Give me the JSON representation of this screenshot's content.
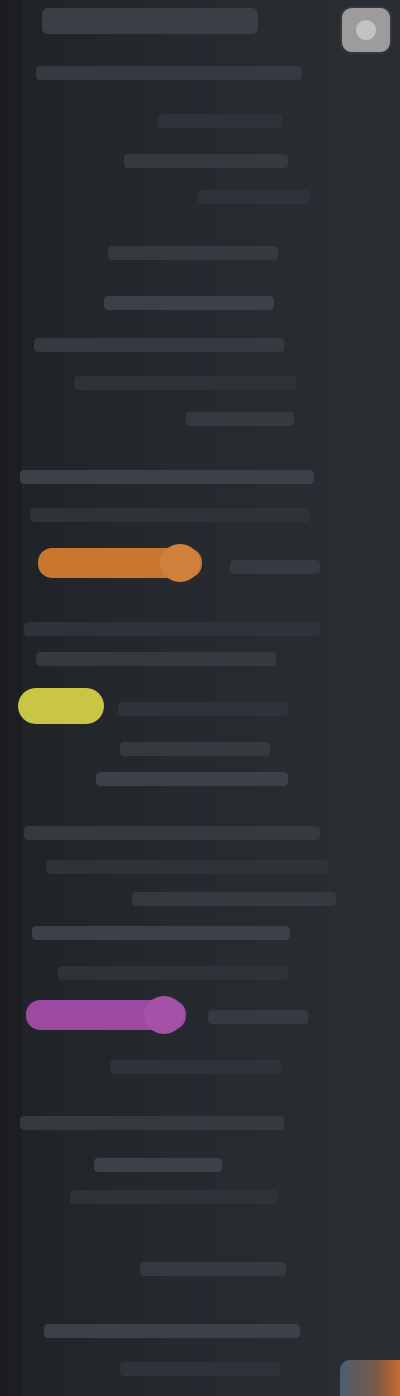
{
  "editor": {
    "tab_title": "",
    "lines": [
      "",
      "",
      "",
      "",
      "",
      "",
      "",
      "",
      "",
      "",
      "",
      "",
      "",
      "",
      "",
      "",
      "",
      "",
      "",
      "",
      "",
      "",
      "",
      "",
      "",
      "",
      "",
      "",
      "",
      ""
    ]
  },
  "colors": {
    "background": "#23272b",
    "highlight_orange": "#c9772f",
    "highlight_yellow": "#c9c545",
    "highlight_purple": "#9c4aa1"
  },
  "icons": {
    "avatar": "avatar-icon",
    "corner_badge": "app-badge-icon"
  }
}
